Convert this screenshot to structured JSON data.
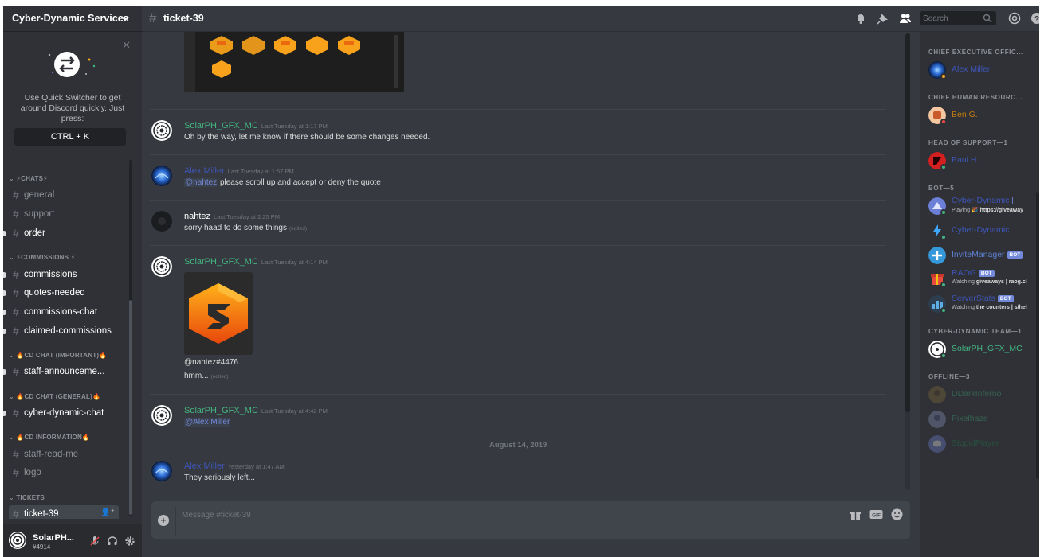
{
  "server": {
    "name": "Cyber-Dynamic Services"
  },
  "quick_switcher": {
    "tip": "Use Quick Switcher to get around Discord quickly. Just press:",
    "shortcut": "CTRL + K"
  },
  "categories": [
    {
      "id": "chats",
      "label": "CHATS"
    },
    {
      "id": "commissions",
      "label": "COMMISSIONS"
    },
    {
      "id": "cd-chat-important",
      "label": "CD CHAT (IMPORTANT)"
    },
    {
      "id": "cd-chat-general",
      "label": "CD CHAT (GENERAL)"
    },
    {
      "id": "cd-information",
      "label": "CD INFORMATION"
    },
    {
      "id": "tickets",
      "label": "TICKETS"
    }
  ],
  "channels": {
    "general": "general",
    "support": "support",
    "order": "order",
    "commissions": "commissions",
    "quotes_needed": "quotes-needed",
    "commissions_chat": "commissions-chat",
    "claimed_commissions": "claimed-commissions",
    "staff_announcements": "staff-announceme...",
    "cyber_dynamic_chat": "cyber-dynamic-chat",
    "staff_read_me": "staff-read-me",
    "logo": "logo",
    "ticket_39": "ticket-39"
  },
  "current_user": {
    "name": "SolarPH...",
    "discriminator": "#4914"
  },
  "topbar": {
    "channel_name": "ticket-39",
    "search_placeholder": "Search"
  },
  "messages": [
    {
      "author": "SolarPH_GFX_MC",
      "timestamp": "Last Tuesday at 1:17 PM",
      "text": "Oh by the way, let me know if there should be some changes needed."
    },
    {
      "author": "Alex Miller",
      "timestamp": "Last Tuesday at 1:57 PM",
      "mention": "@nahtez",
      "text": " please scroll up and accept or deny the quote"
    },
    {
      "author": "nahtez",
      "timestamp": "Last Tuesday at 2:25 PM",
      "text": "sorry haad to do some things",
      "edited": "(edited)"
    },
    {
      "author": "SolarPH_GFX_MC",
      "timestamp": "Last Tuesday at 4:14 PM",
      "line1": "@nahtez#4476",
      "line2": "hmm...",
      "edited": "(edited)"
    },
    {
      "author": "SolarPH_GFX_MC",
      "timestamp": "Last Tuesday at 4:42 PM",
      "mention": "@Alex Miller"
    },
    {
      "author": "Alex Miller",
      "timestamp": "Yesterday at 1:47 AM",
      "text": "They seriously left..."
    }
  ],
  "date_separator": "August 14, 2019",
  "composer": {
    "placeholder": "Message #ticket-39"
  },
  "members": {
    "categories": {
      "ceo": "CHIEF EXECUTIVE OFFIC...",
      "chro": "CHIEF HUMAN RESOURC...",
      "head_support": "HEAD OF SUPPORT—1",
      "bot": "BOT—5",
      "team": "CYBER-DYNAMIC TEAM—1",
      "offline": "OFFLINE—3"
    },
    "list": {
      "alex": "Alex Miller",
      "ben": "Ben G.",
      "paul": "Paul H.",
      "cyber1": "Cyber-Dynamic",
      "cyber1_activity_prefix": "Playing 🎉",
      "cyber1_activity": "https://giveaway",
      "cyber2": "Cyber-Dynamic",
      "invite": "InviteManager",
      "raog": "RAOG",
      "raog_activity_prefix": "Watching",
      "raog_activity": "giveaways | raog.cl",
      "serverstats": "ServerStats",
      "serverstats_activity_prefix": "Watching",
      "serverstats_activity": "the counters | s/hel",
      "solar": "SolarPH_GFX_MC",
      "ddark": "DDarkInferno",
      "pixelhaze": "Pixelhaze",
      "stupid": "StupidPlayer"
    },
    "bot_tag": "BOT"
  },
  "colors": {
    "online": "#43b581",
    "dnd": "#f04747",
    "blurple": "#7289da",
    "background": "#36393f"
  }
}
